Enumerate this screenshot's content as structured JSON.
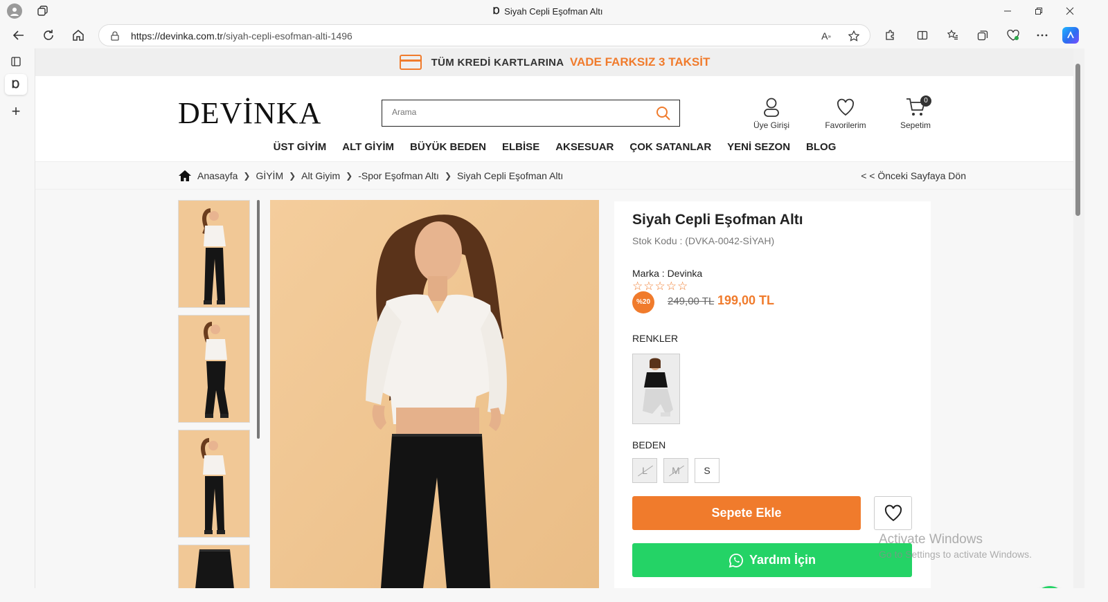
{
  "browser": {
    "tab_title": "Siyah Cepli Eşofman Altı",
    "url_domain": "https://devinka.com.tr",
    "url_path": "/siyah-cepli-esofman-alti-1496",
    "icons": [
      "profile-icon",
      "workspaces-icon",
      "back-icon",
      "refresh-icon",
      "home-icon",
      "lock-icon",
      "read-aloud-icon",
      "favorite-star-icon",
      "extensions-icon",
      "split-screen-icon",
      "favorites-icon",
      "collections-icon",
      "browser-essentials-icon",
      "more-icon",
      "copilot-icon",
      "minimize-icon",
      "restore-icon",
      "close-icon"
    ]
  },
  "promo": {
    "text": "TÜM KREDİ KARTLARINA",
    "highlight": "VADE FARKSIZ 3 TAKSİT"
  },
  "header": {
    "logo": "DEVİNKA",
    "search_placeholder": "Arama",
    "account_label": "Üye Girişi",
    "favorites_label": "Favorilerim",
    "cart_label": "Sepetim",
    "cart_count": "0"
  },
  "nav": {
    "items": [
      "ÜST GİYİM",
      "ALT GİYİM",
      "BÜYÜK BEDEN",
      "ELBİSE",
      "AKSESUAR",
      "ÇOK SATANLAR",
      "YENİ SEZON",
      "BLOG"
    ]
  },
  "breadcrumb": {
    "items": [
      "Anasayfa",
      "GİYİM",
      "Alt Giyim",
      "-Spor Eşofman Altı",
      "Siyah Cepli Eşofman Altı"
    ],
    "back_link": "< < Önceki Sayfaya Dön"
  },
  "product": {
    "title": "Siyah Cepli Eşofman Altı",
    "stock_code": "Stok Kodu : (DVKA-0042-SİYAH)",
    "brand": "Marka : Devinka",
    "rating": 0,
    "rating_max": 5,
    "discount_badge": "%20",
    "old_price": "249,00 TL",
    "price": "199,00 TL",
    "colors_label": "RENKLER",
    "size_label": "BEDEN",
    "sizes": [
      {
        "label": "L",
        "available": false
      },
      {
        "label": "M",
        "available": false
      },
      {
        "label": "S",
        "available": true
      }
    ],
    "add_to_cart": "Sepete Ekle",
    "help_button": "Yardım İçin"
  },
  "colors": {
    "accent": "#f07b2c",
    "whatsapp": "#24d366"
  },
  "watermark": {
    "line1": "Activate Windows",
    "line2": "Go to Settings to activate Windows."
  }
}
